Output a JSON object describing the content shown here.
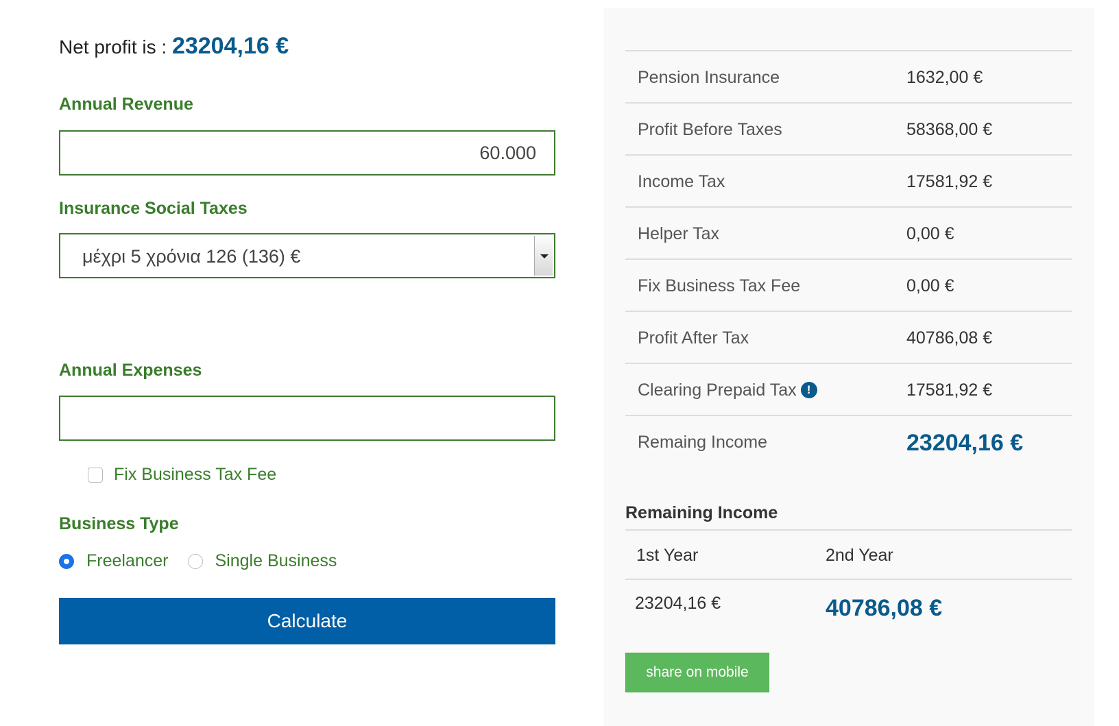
{
  "summary": {
    "net_profit_label": "Net profit is :",
    "net_profit_value": "23204,16 €"
  },
  "form": {
    "annual_revenue_label": "Annual Revenue",
    "annual_revenue_value": "60.000",
    "insurance_label": "Insurance Social Taxes",
    "insurance_selected": "μέχρι 5 χρόνια 126 (136) €",
    "annual_expenses_label": "Annual Expenses",
    "annual_expenses_value": "",
    "fix_business_tax_label": "Fix Business Tax Fee",
    "fix_business_tax_checked": false,
    "business_type_label": "Business Type",
    "business_types": [
      {
        "label": "Freelancer",
        "checked": true
      },
      {
        "label": "Single Business",
        "checked": false
      }
    ],
    "calculate_label": "Calculate"
  },
  "results": {
    "rows": [
      {
        "label": "Pension Insurance",
        "value": "1632,00 €"
      },
      {
        "label": "Profit Before Taxes",
        "value": "58368,00 €"
      },
      {
        "label": "Income Tax",
        "value": "17581,92 €"
      },
      {
        "label": "Helper Tax",
        "value": "0,00 €"
      },
      {
        "label": "Fix Business Tax Fee",
        "value": "0,00 €"
      },
      {
        "label": "Profit After Tax",
        "value": "40786,08 €"
      },
      {
        "label": "Clearing Prepaid Tax",
        "value": "17581,92 €",
        "icon": "info-icon"
      },
      {
        "label": "Remaing Income",
        "value": "23204,16 €"
      }
    ]
  },
  "remaining": {
    "title": "Remaining Income",
    "col1_label": "1st Year",
    "col2_label": "2nd Year",
    "col1_value": "23204,16 €",
    "col2_value": "40786,08 €"
  },
  "share_label": "share on mobile",
  "colors": {
    "label_green": "#3a7d2c",
    "accent_blue": "#0a5a8c",
    "button_blue": "#005fa6",
    "share_green": "#5cb85c"
  }
}
